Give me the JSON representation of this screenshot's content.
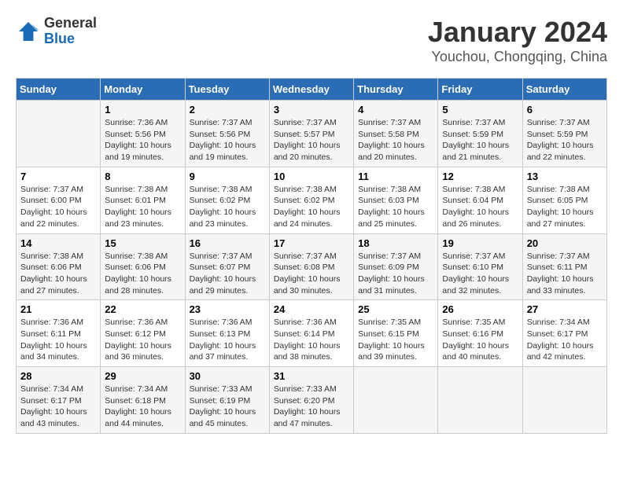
{
  "logo": {
    "general": "General",
    "blue": "Blue"
  },
  "title": "January 2024",
  "location": "Youchou, Chongqing, China",
  "days_of_week": [
    "Sunday",
    "Monday",
    "Tuesday",
    "Wednesday",
    "Thursday",
    "Friday",
    "Saturday"
  ],
  "weeks": [
    [
      {
        "day": null
      },
      {
        "day": 1,
        "sunrise": "7:36 AM",
        "sunset": "5:56 PM",
        "daylight": "10 hours and 19 minutes."
      },
      {
        "day": 2,
        "sunrise": "7:37 AM",
        "sunset": "5:56 PM",
        "daylight": "10 hours and 19 minutes."
      },
      {
        "day": 3,
        "sunrise": "7:37 AM",
        "sunset": "5:57 PM",
        "daylight": "10 hours and 20 minutes."
      },
      {
        "day": 4,
        "sunrise": "7:37 AM",
        "sunset": "5:58 PM",
        "daylight": "10 hours and 20 minutes."
      },
      {
        "day": 5,
        "sunrise": "7:37 AM",
        "sunset": "5:59 PM",
        "daylight": "10 hours and 21 minutes."
      },
      {
        "day": 6,
        "sunrise": "7:37 AM",
        "sunset": "5:59 PM",
        "daylight": "10 hours and 22 minutes."
      }
    ],
    [
      {
        "day": 7,
        "sunrise": "7:37 AM",
        "sunset": "6:00 PM",
        "daylight": "10 hours and 22 minutes."
      },
      {
        "day": 8,
        "sunrise": "7:38 AM",
        "sunset": "6:01 PM",
        "daylight": "10 hours and 23 minutes."
      },
      {
        "day": 9,
        "sunrise": "7:38 AM",
        "sunset": "6:02 PM",
        "daylight": "10 hours and 23 minutes."
      },
      {
        "day": 10,
        "sunrise": "7:38 AM",
        "sunset": "6:02 PM",
        "daylight": "10 hours and 24 minutes."
      },
      {
        "day": 11,
        "sunrise": "7:38 AM",
        "sunset": "6:03 PM",
        "daylight": "10 hours and 25 minutes."
      },
      {
        "day": 12,
        "sunrise": "7:38 AM",
        "sunset": "6:04 PM",
        "daylight": "10 hours and 26 minutes."
      },
      {
        "day": 13,
        "sunrise": "7:38 AM",
        "sunset": "6:05 PM",
        "daylight": "10 hours and 27 minutes."
      }
    ],
    [
      {
        "day": 14,
        "sunrise": "7:38 AM",
        "sunset": "6:06 PM",
        "daylight": "10 hours and 27 minutes."
      },
      {
        "day": 15,
        "sunrise": "7:38 AM",
        "sunset": "6:06 PM",
        "daylight": "10 hours and 28 minutes."
      },
      {
        "day": 16,
        "sunrise": "7:37 AM",
        "sunset": "6:07 PM",
        "daylight": "10 hours and 29 minutes."
      },
      {
        "day": 17,
        "sunrise": "7:37 AM",
        "sunset": "6:08 PM",
        "daylight": "10 hours and 30 minutes."
      },
      {
        "day": 18,
        "sunrise": "7:37 AM",
        "sunset": "6:09 PM",
        "daylight": "10 hours and 31 minutes."
      },
      {
        "day": 19,
        "sunrise": "7:37 AM",
        "sunset": "6:10 PM",
        "daylight": "10 hours and 32 minutes."
      },
      {
        "day": 20,
        "sunrise": "7:37 AM",
        "sunset": "6:11 PM",
        "daylight": "10 hours and 33 minutes."
      }
    ],
    [
      {
        "day": 21,
        "sunrise": "7:36 AM",
        "sunset": "6:11 PM",
        "daylight": "10 hours and 34 minutes."
      },
      {
        "day": 22,
        "sunrise": "7:36 AM",
        "sunset": "6:12 PM",
        "daylight": "10 hours and 36 minutes."
      },
      {
        "day": 23,
        "sunrise": "7:36 AM",
        "sunset": "6:13 PM",
        "daylight": "10 hours and 37 minutes."
      },
      {
        "day": 24,
        "sunrise": "7:36 AM",
        "sunset": "6:14 PM",
        "daylight": "10 hours and 38 minutes."
      },
      {
        "day": 25,
        "sunrise": "7:35 AM",
        "sunset": "6:15 PM",
        "daylight": "10 hours and 39 minutes."
      },
      {
        "day": 26,
        "sunrise": "7:35 AM",
        "sunset": "6:16 PM",
        "daylight": "10 hours and 40 minutes."
      },
      {
        "day": 27,
        "sunrise": "7:34 AM",
        "sunset": "6:17 PM",
        "daylight": "10 hours and 42 minutes."
      }
    ],
    [
      {
        "day": 28,
        "sunrise": "7:34 AM",
        "sunset": "6:17 PM",
        "daylight": "10 hours and 43 minutes."
      },
      {
        "day": 29,
        "sunrise": "7:34 AM",
        "sunset": "6:18 PM",
        "daylight": "10 hours and 44 minutes."
      },
      {
        "day": 30,
        "sunrise": "7:33 AM",
        "sunset": "6:19 PM",
        "daylight": "10 hours and 45 minutes."
      },
      {
        "day": 31,
        "sunrise": "7:33 AM",
        "sunset": "6:20 PM",
        "daylight": "10 hours and 47 minutes."
      },
      {
        "day": null
      },
      {
        "day": null
      },
      {
        "day": null
      }
    ]
  ],
  "labels": {
    "sunrise": "Sunrise:",
    "sunset": "Sunset:",
    "daylight": "Daylight:"
  }
}
